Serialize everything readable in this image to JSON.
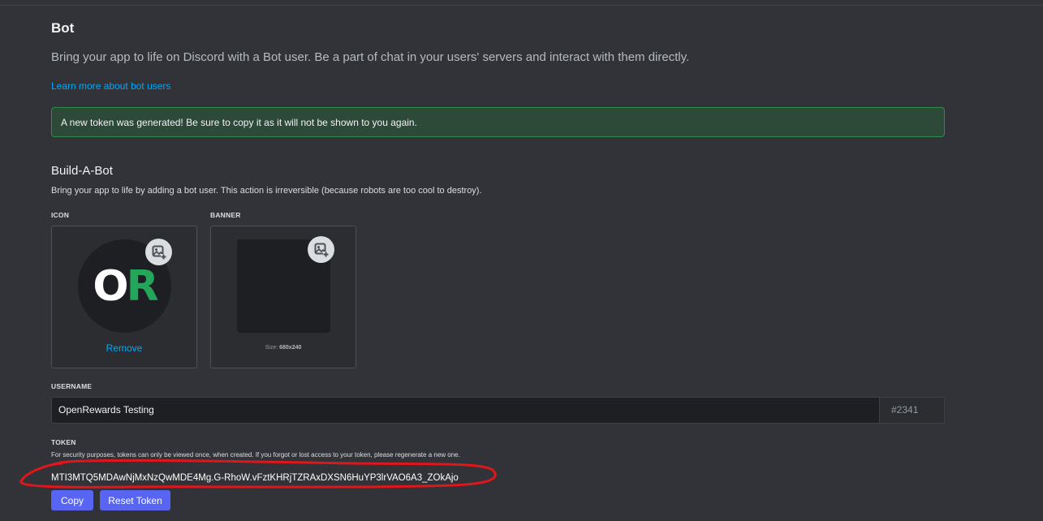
{
  "header": {
    "title": "Bot",
    "description": "Bring your app to life on Discord with a Bot user. Be a part of chat in your users' servers and interact with them directly.",
    "learn_more": "Learn more about bot users"
  },
  "notice": {
    "text": "A new token was generated! Be sure to copy it as it will not be shown to you again."
  },
  "build_a_bot": {
    "title": "Build-A-Bot",
    "description": "Bring your app to life by adding a bot user. This action is irreversible (because robots are too cool to destroy).",
    "icon_label": "ICON",
    "banner_label": "BANNER",
    "avatar_letter_1": "O",
    "avatar_letter_2": "R",
    "remove_label": "Remove",
    "size_prefix": "Size:",
    "size_value": "680x240"
  },
  "username": {
    "label": "USERNAME",
    "value": "OpenRewards Testing",
    "discriminator": "#2341"
  },
  "token": {
    "label": "TOKEN",
    "help": "For security purposes, tokens can only be viewed once, when created. If you forgot or lost access to your token, please regenerate a new one.",
    "value": "MTI3MTQ5MDAwNjMxNzQwMDE4Mg.G-RhoW.vFztKHRjTZRAxDXSN6HuYP3lrVAO6A3_ZOkAjo",
    "copy_label": "Copy",
    "reset_label": "Reset Token"
  },
  "colors": {
    "background": "#313338",
    "accent": "#5865f2",
    "link": "#00a8fc",
    "success_bg": "#2d4a38",
    "success_border": "#2f8a4e",
    "annotation_red": "#e0161b"
  },
  "icons": {
    "edit_icon": "image-plus-icon",
    "edit_banner": "image-plus-icon"
  }
}
